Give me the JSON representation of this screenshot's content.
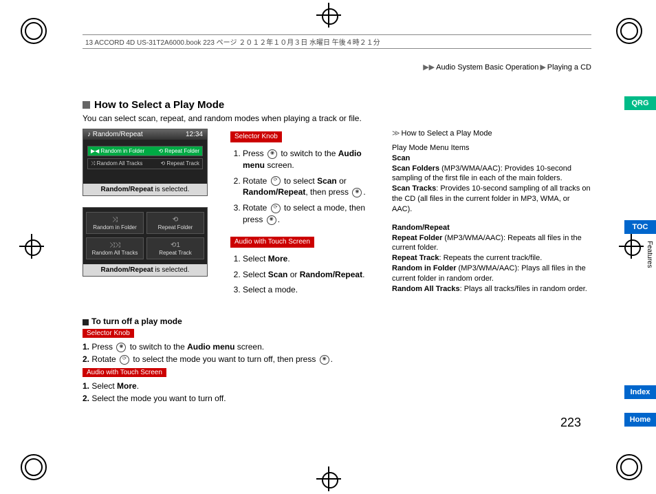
{
  "header_line": "13 ACCORD 4D US-31T2A6000.book  223 ページ  ２０１２年１０月３日  水曜日  午後４時２１分",
  "breadcrumb": {
    "a": "Audio System Basic Operation",
    "b": "Playing a CD"
  },
  "section_title": "How to Select a Play Mode",
  "intro": "You can select scan, repeat, and random modes when playing a track or file.",
  "pill_selector": "Selector Knob",
  "pill_touch": "Audio with Touch Screen",
  "screen1": {
    "top_left": "♪  Random/Repeat",
    "top_right": "12:34",
    "row1_l": "▶◀ Random in Folder",
    "row1_r": "⟲ Repeat Folder",
    "row2_l": "⤨ Random All Tracks",
    "row2_r": "⟲ Repeat Track",
    "caption_b": "Random/Repeat",
    "caption_rest": " is selected."
  },
  "steps_selector": {
    "s1_a": "Press ",
    "s1_b": " to switch to the ",
    "s1_c": "Audio menu",
    "s1_d": " screen.",
    "s2_a": "Rotate ",
    "s2_b": " to select ",
    "s2_c": "Scan",
    "s2_d": " or ",
    "s2_e": "Random/Repeat",
    "s2_f": ", then press ",
    "s2_g": ".",
    "s3_a": "Rotate ",
    "s3_b": " to select a mode, then press ",
    "s3_c": "."
  },
  "screen2": {
    "btn1": "Random in Folder",
    "btn2": "Repeat Folder",
    "btn3": "Random All Tracks",
    "btn4": "Repeat Track",
    "caption_b": "Random/Repeat",
    "caption_rest": " is selected."
  },
  "steps_touch": {
    "s1_a": "Select ",
    "s1_b": "More",
    "s1_c": ".",
    "s2_a": "Select ",
    "s2_b": "Scan",
    "s2_c": " or ",
    "s2_d": "Random/Repeat",
    "s2_e": ".",
    "s3": "Select a mode."
  },
  "turnoff_title": "To turn off a play mode",
  "turnoff_sel": {
    "s1_a": "Press ",
    "s1_b": " to switch to the ",
    "s1_c": "Audio menu",
    "s1_d": " screen.",
    "s2_a": "Rotate ",
    "s2_b": " to select the mode you want to turn off, then press ",
    "s2_c": "."
  },
  "turnoff_touch": {
    "s1_a": "Select ",
    "s1_b": "More",
    "s1_c": ".",
    "s2": "Select the mode you want to turn off."
  },
  "right": {
    "head": "How to Select a Play Mode",
    "sub": "Play Mode Menu Items",
    "scan_h": "Scan",
    "scan1_b": "Scan Folders",
    "scan1_t": " (MP3/WMA/AAC): Provides 10-second sampling of the first file in each of the main folders.",
    "scan2_b": "Scan Tracks",
    "scan2_t": ": Provides 10-second sampling of all tracks on the CD (all files in the current folder in MP3, WMA, or AAC).",
    "rr_h": "Random/Repeat",
    "rr1_b": "Repeat Folder",
    "rr1_t": " (MP3/WMA/AAC): Repeats all files in the current folder.",
    "rr2_b": "Repeat Track",
    "rr2_t": ": Repeats the current track/file.",
    "rr3_b": "Random in Folder",
    "rr3_t": " (MP3/WMA/AAC): Plays all files in the current folder in random order.",
    "rr4_b": "Random All Tracks",
    "rr4_t": ": Plays all tracks/files in random order."
  },
  "nav": {
    "qrg": "QRG",
    "toc": "TOC",
    "idx": "Index",
    "home": "Home"
  },
  "vtext": "Features",
  "pagenum": "223"
}
